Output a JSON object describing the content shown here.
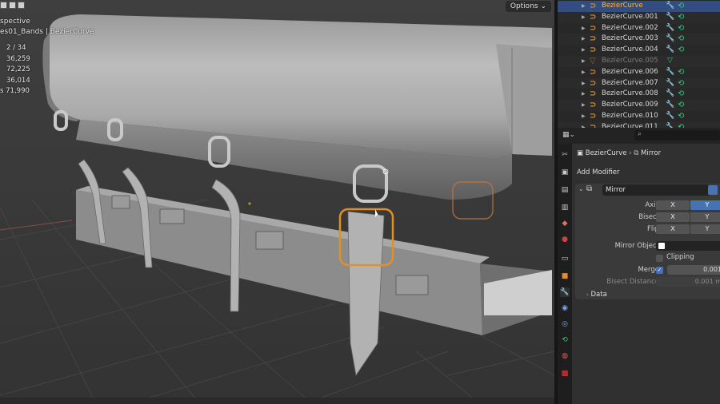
{
  "viewport": {
    "view_label": "spective",
    "collection_label": "es01_Bands | BezierCurve",
    "options_label": "Options",
    "stats": [
      "2 / 34",
      "36,259",
      "72,225",
      "36,014",
      "71,990"
    ],
    "stats_prefix_last": "s"
  },
  "outliner": {
    "items": [
      {
        "name": "BezierCurve",
        "selected": true,
        "dim": false
      },
      {
        "name": "BezierCurve.001",
        "selected": false,
        "dim": false
      },
      {
        "name": "BezierCurve.002",
        "selected": false,
        "dim": false
      },
      {
        "name": "BezierCurve.003",
        "selected": false,
        "dim": false
      },
      {
        "name": "BezierCurve.004",
        "selected": false,
        "dim": false
      },
      {
        "name": "BezierCurve.005",
        "selected": false,
        "dim": true
      },
      {
        "name": "BezierCurve.006",
        "selected": false,
        "dim": false
      },
      {
        "name": "BezierCurve.007",
        "selected": false,
        "dim": false
      },
      {
        "name": "BezierCurve.008",
        "selected": false,
        "dim": false
      },
      {
        "name": "BezierCurve.009",
        "selected": false,
        "dim": false
      },
      {
        "name": "BezierCurve.010",
        "selected": false,
        "dim": false
      },
      {
        "name": "BezierCurve.011",
        "selected": false,
        "dim": false
      }
    ]
  },
  "properties": {
    "object_name": "BezierCurve",
    "modifier_crumb": "Mirror",
    "add_modifier_label": "Add Modifier",
    "modifier": {
      "name": "Mirror",
      "axis_label": "Axis",
      "bisect_label": "Bisect",
      "flip_label": "Flip",
      "x": "X",
      "y": "Y",
      "axis": {
        "x": false,
        "y": true
      },
      "bisect": {
        "x": false,
        "y": false
      },
      "flip": {
        "x": false,
        "y": false
      },
      "mirror_object_label": "Mirror Object",
      "clipping_label": "Clipping",
      "clipping": false,
      "merge_label": "Merge",
      "merge": true,
      "merge_value": "0.001",
      "bisect_distance_label": "Bisect Distance",
      "bisect_distance_value": "0.001 m",
      "data_label": "Data"
    }
  },
  "colors": {
    "selection": "#334d80",
    "accent_orange": "#e0902a",
    "toggle_blue": "#4772b3",
    "modifier_green": "#3cc37b"
  }
}
